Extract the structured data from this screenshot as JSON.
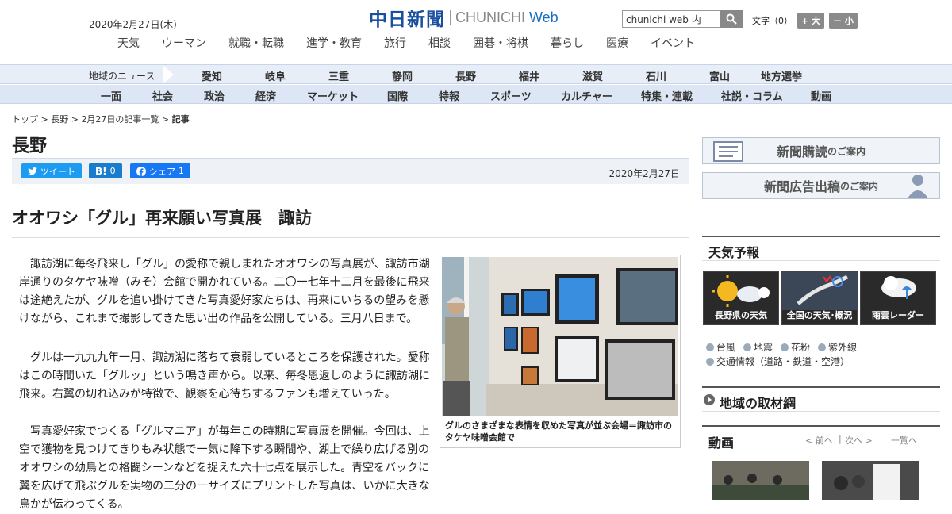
{
  "header": {
    "date": "2020年2月27日(木)",
    "logo_jp": "中日新聞",
    "logo_en": "CHUNICHI",
    "logo_web": "Web",
    "search_value": "chunichi web 内",
    "font_label": "文字（0）",
    "font_plus": "+ 大",
    "font_minus": "－ 小"
  },
  "nav_main": [
    "天気",
    "ウーマン",
    "就職・転職",
    "進学・教育",
    "旅行",
    "相談",
    "囲碁・将棋",
    "暮らし",
    "医療",
    "イベント"
  ],
  "nav_region": {
    "label": "地域のニュース",
    "items": [
      "愛知",
      "岐阜",
      "三重",
      "静岡",
      "長野",
      "福井",
      "滋賀",
      "石川",
      "富山",
      "地方選挙"
    ]
  },
  "nav_category": [
    "一面",
    "社会",
    "政治",
    "経済",
    "マーケット",
    "国際",
    "特報",
    "スポーツ",
    "カルチャー",
    "特集・連載",
    "社説・コラム",
    "動画"
  ],
  "breadcrumb": {
    "top": "トップ",
    "region": "長野",
    "list": "2月27日の記事一覧",
    "current": "記事"
  },
  "section_title": "長野",
  "share": {
    "tweet": "ツイート",
    "hatena_count": "0",
    "facebook": "シェア",
    "facebook_count": "1"
  },
  "article": {
    "date": "2020年2月27日",
    "headline": "オオワシ「グル」再来願い写真展　諏訪",
    "p1": "諏訪湖に毎冬飛来し「グル」の愛称で親しまれたオオワシの写真展が、諏訪市湖岸通りのタケヤ味噌（みそ）会館で開かれている。二〇一七年十二月を最後に飛来は途絶えたが、グルを追い掛けてきた写真愛好家たちは、再来にいちるの望みを懸けながら、これまで撮影してきた思い出の作品を公開している。三月八日まで。",
    "p2": "グルは一九九九年一月、諏訪湖に落ちて衰弱しているところを保護された。愛称はこの時間いた「グルッ」という鳴き声から。以来、毎冬恩返しのように諏訪湖に飛来。右翼の切れ込みが特徴で、観察を心待ちするファンも増えていった。",
    "p3": "写真愛好家でつくる「グルマニア」が毎年この時期に写真展を開催。今回は、上空で獲物を見つけてきりもみ状態で一気に降下する瞬間や、湖上で繰り広げる別のオオワシの幼鳥との格闘シーンなどを捉えた六十七点を展示した。青空をバックに翼を広げて飛ぶグルを実物の二分の一サイズにプリントした写真は、いかに大きな鳥かが伝わってくる。",
    "caption": "グルのさまざまな表情を収めた写真が並ぶ会場＝諏訪市のタケヤ味噌会館で"
  },
  "sidebar": {
    "banner1": "新聞購読",
    "banner1_suffix": "のご案内",
    "banner2": "新聞広告出稿",
    "banner2_suffix": "のご案内",
    "weather_title": "天気予報",
    "weather_tiles": [
      "長野県の天気",
      "全国の天気･概況",
      "雨雲レーダー"
    ],
    "weather_links_1": [
      "台風",
      "地震",
      "花粉",
      "紫外線"
    ],
    "weather_links_2": [
      "交通情報（道路・鉄道・空港）"
    ],
    "region_net": "地域の取材網",
    "video_title": "動画",
    "video_prev": "< 前へ",
    "video_next": "次へ >",
    "video_list": "一覧へ"
  }
}
